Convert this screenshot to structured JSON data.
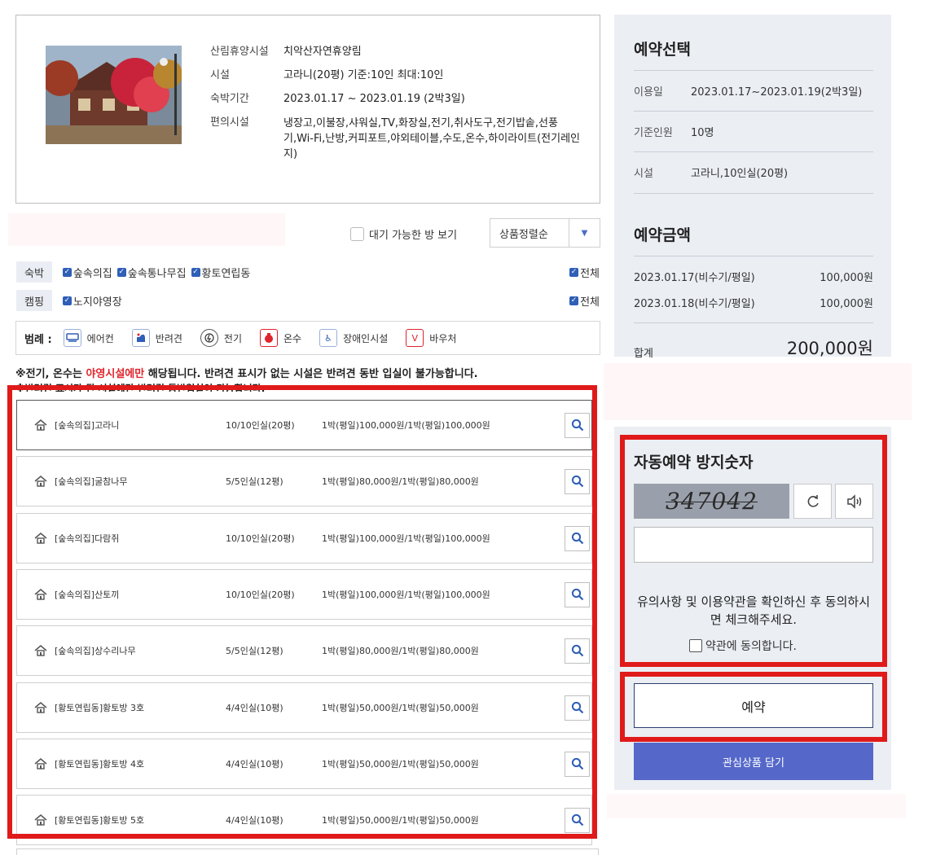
{
  "facility": {
    "rows": [
      {
        "label": "산림휴양시설",
        "value": "치악산자연휴양림"
      },
      {
        "label": "시설",
        "value": "고라니(20평) 기준:10인 최대:10인"
      },
      {
        "label": "숙박기간",
        "value": "2023.01.17 ~ 2023.01.19 (2박3일)"
      },
      {
        "label": "편의시설",
        "value": "냉장고,이불장,샤워실,TV,화장실,전기,취사도구,전기밥솥,선풍기,Wi-Fi,난방,커피포트,야외테이블,수도,온수,하이라이트(전기레인지)"
      }
    ]
  },
  "filters": {
    "waiting_label": "대기 가능한 방 보기",
    "sort_label": "상품정렬순",
    "lodging": {
      "tag": "숙박",
      "options": [
        "숲속의집",
        "숲속통나무집",
        "황토연립동"
      ],
      "all": "전체"
    },
    "camping": {
      "tag": "캠핑",
      "options": [
        "노지야영장"
      ],
      "all": "전체"
    }
  },
  "legend": {
    "title": "범례 :",
    "items": [
      {
        "icon": "air-conditioner-icon",
        "label": "에어컨",
        "color": "#2f5fb7"
      },
      {
        "icon": "pet-icon",
        "label": "반려견",
        "color": "#2f5fb7"
      },
      {
        "icon": "electricity-icon",
        "label": "전기",
        "color": "#333333"
      },
      {
        "icon": "hot-water-icon",
        "label": "온수",
        "color": "#e0242b"
      },
      {
        "icon": "accessibility-icon",
        "label": "장애인시설",
        "color": "#2f5fb7"
      },
      {
        "icon": "voucher-icon",
        "label": "바우처",
        "color": "#e0242b"
      }
    ]
  },
  "notice": {
    "line1_a": "※전기, 온수는 ",
    "line1_b": "야영시설에만",
    "line1_c": " 해당됩니다. 반려견 표시가 없는 시설은 반려견 동반 입실이 불가능합니다.",
    "line2": "※반려견 표시가 된 시설에만 반려견 동반입실이 가능합니다."
  },
  "rooms": [
    {
      "name": "[숲속의집]고라니",
      "capacity": "10/10인실(20평)",
      "price": "1박(평일)100,000원/1박(평일)100,000원"
    },
    {
      "name": "[숲속의집]굴참나무",
      "capacity": "5/5인실(12평)",
      "price": "1박(평일)80,000원/1박(평일)80,000원"
    },
    {
      "name": "[숲속의집]다람쥐",
      "capacity": "10/10인실(20평)",
      "price": "1박(평일)100,000원/1박(평일)100,000원"
    },
    {
      "name": "[숲속의집]산토끼",
      "capacity": "10/10인실(20평)",
      "price": "1박(평일)100,000원/1박(평일)100,000원"
    },
    {
      "name": "[숲속의집]상수리나무",
      "capacity": "5/5인실(12평)",
      "price": "1박(평일)80,000원/1박(평일)80,000원"
    },
    {
      "name": "[황토연립동]황토방 3호",
      "capacity": "4/4인실(10평)",
      "price": "1박(평일)50,000원/1박(평일)50,000원"
    },
    {
      "name": "[황토연립동]황토방 4호",
      "capacity": "4/4인실(10평)",
      "price": "1박(평일)50,000원/1박(평일)50,000원"
    },
    {
      "name": "[황토연립동]황토방 5호",
      "capacity": "4/4인실(10평)",
      "price": "1박(평일)50,000원/1박(평일)50,000원"
    }
  ],
  "reservation": {
    "title": "예약선택",
    "date_label": "이용일",
    "date_value": "2023.01.17~2023.01.19(2박3일)",
    "people_label": "기준인원",
    "people_value": "10명",
    "facility_label": "시설",
    "facility_value": "고라니,10인실(20평)"
  },
  "amount": {
    "title": "예약금액",
    "items": [
      {
        "label": "2023.01.17(비수기/평일)",
        "value": "100,000원"
      },
      {
        "label": "2023.01.18(비수기/평일)",
        "value": "100,000원"
      }
    ],
    "total_label": "합계",
    "total_value": "200,000원"
  },
  "captcha": {
    "title": "자동예약 방지숫자",
    "code": "347042",
    "agree_text": "유의사항 및 이용약관을 확인하신 후 동의하시면 체크해주세요.",
    "agree_label": "약관에 동의합니다."
  },
  "buttons": {
    "reserve": "예약",
    "wishlist": "관심상품 담기"
  },
  "colors": {
    "highlight_red": "#e01a1a",
    "accent_blue": "#2f5fb7",
    "wishlist_blue": "#5568c9",
    "panel_bg": "#ebeef3"
  }
}
